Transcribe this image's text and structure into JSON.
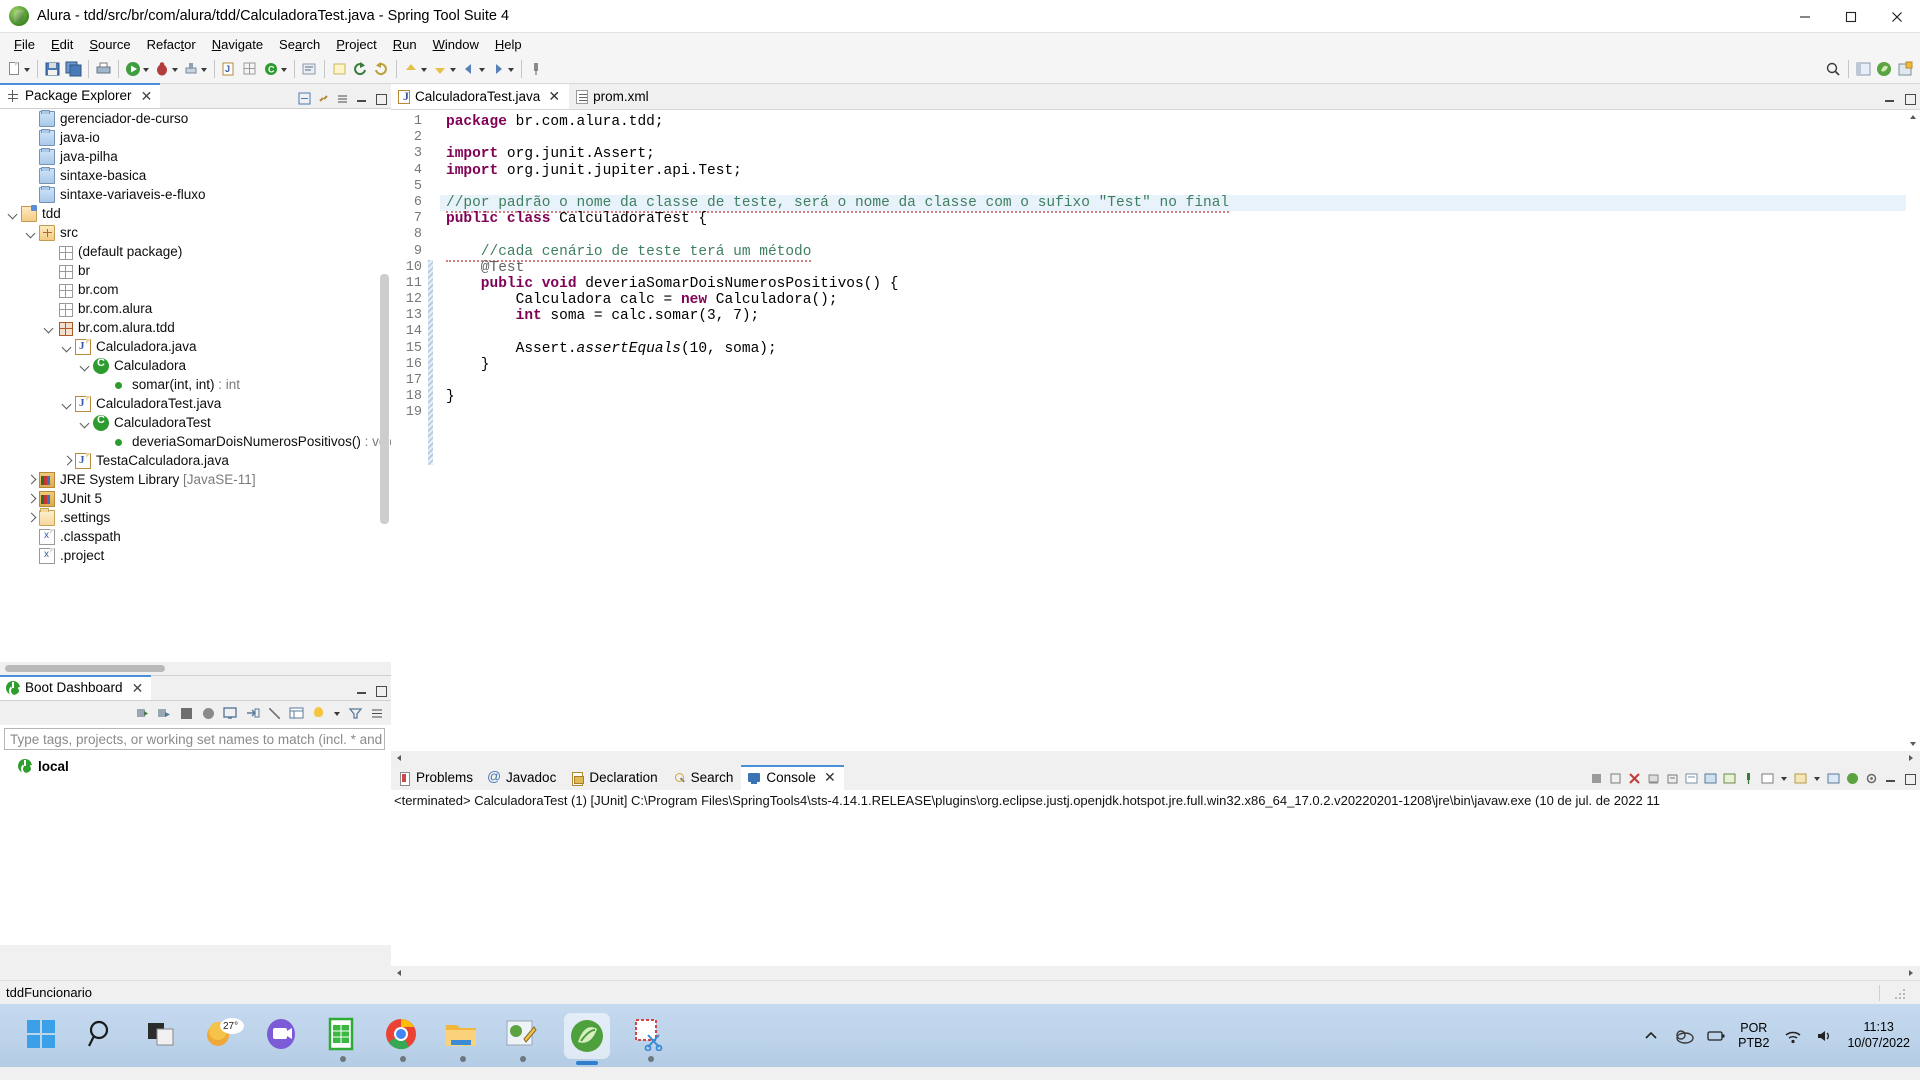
{
  "window": {
    "title": "Alura - tdd/src/br/com/alura/tdd/CalculadoraTest.java - Spring Tool Suite 4",
    "app_icon": "spring-leaf-icon",
    "minimize": "minimize-icon",
    "maximize": "maximize-icon",
    "close": "close-icon"
  },
  "menubar": {
    "items": [
      {
        "label": "File",
        "mnemonic": "F"
      },
      {
        "label": "Edit",
        "mnemonic": "E"
      },
      {
        "label": "Source",
        "mnemonic": "S"
      },
      {
        "label": "Refactor",
        "mnemonic": "t"
      },
      {
        "label": "Navigate",
        "mnemonic": "N"
      },
      {
        "label": "Search",
        "mnemonic": "a"
      },
      {
        "label": "Project",
        "mnemonic": "P"
      },
      {
        "label": "Run",
        "mnemonic": "R"
      },
      {
        "label": "Window",
        "mnemonic": "W"
      },
      {
        "label": "Help",
        "mnemonic": "H"
      }
    ]
  },
  "package_explorer": {
    "tab_label": "Package Explorer",
    "tab_icon": "package-explorer-icon",
    "close_icon": "close-icon",
    "tree": [
      {
        "label": "gerenciador-de-curso",
        "indent": 1,
        "twisty": "none",
        "icon": "project-folder-icon"
      },
      {
        "label": "java-io",
        "indent": 1,
        "twisty": "none",
        "icon": "project-folder-icon"
      },
      {
        "label": "java-pilha",
        "indent": 1,
        "twisty": "none",
        "icon": "project-folder-icon"
      },
      {
        "label": "sintaxe-basica",
        "indent": 1,
        "twisty": "none",
        "icon": "project-folder-icon"
      },
      {
        "label": "sintaxe-variaveis-e-fluxo",
        "indent": 1,
        "twisty": "none",
        "icon": "project-folder-icon"
      },
      {
        "label": "tdd",
        "indent": 0,
        "twisty": "open",
        "icon": "open-project-folder-icon"
      },
      {
        "label": "src",
        "indent": 1,
        "twisty": "open",
        "icon": "source-folder-icon"
      },
      {
        "label": "(default package)",
        "indent": 2,
        "twisty": "none",
        "icon": "package-icon"
      },
      {
        "label": "br",
        "indent": 2,
        "twisty": "none",
        "icon": "package-icon"
      },
      {
        "label": "br.com",
        "indent": 2,
        "twisty": "none",
        "icon": "package-icon"
      },
      {
        "label": "br.com.alura",
        "indent": 2,
        "twisty": "none",
        "icon": "package-icon"
      },
      {
        "label": "br.com.alura.tdd",
        "indent": 2,
        "twisty": "open",
        "icon": "package-selected-icon"
      },
      {
        "label": "Calculadora.java",
        "indent": 3,
        "twisty": "open",
        "icon": "java-file-icon"
      },
      {
        "label": "Calculadora",
        "indent": 4,
        "twisty": "open",
        "icon": "class-icon"
      },
      {
        "label": "somar(int, int)",
        "suffix": " : int",
        "indent": 5,
        "twisty": "none",
        "icon": "method-icon"
      },
      {
        "label": "CalculadoraTest.java",
        "indent": 3,
        "twisty": "open",
        "icon": "java-file-icon"
      },
      {
        "label": "CalculadoraTest",
        "indent": 4,
        "twisty": "open",
        "icon": "class-icon"
      },
      {
        "label": "deveriaSomarDoisNumerosPositivos()",
        "suffix": " : void",
        "indent": 5,
        "twisty": "none",
        "icon": "method-icon"
      },
      {
        "label": "TestaCalculadora.java",
        "indent": 3,
        "twisty": "closed",
        "icon": "java-file-icon"
      },
      {
        "label": "JRE System Library",
        "suffix": " [JavaSE-11]",
        "indent": 1,
        "twisty": "closed",
        "icon": "library-icon"
      },
      {
        "label": "JUnit 5",
        "indent": 1,
        "twisty": "closed",
        "icon": "library-icon"
      },
      {
        "label": ".settings",
        "indent": 1,
        "twisty": "closed",
        "icon": "folder-icon"
      },
      {
        "label": ".classpath",
        "indent": 1,
        "twisty": "none",
        "icon": "xml-file-icon"
      },
      {
        "label": ".project",
        "indent": 1,
        "twisty": "none",
        "icon": "xml-file-icon"
      }
    ]
  },
  "boot_dashboard": {
    "tab_label": "Boot Dashboard",
    "tab_icon": "spring-boot-icon",
    "close_icon": "close-icon",
    "search_placeholder": "Type tags, projects, or working set names to match (incl. * and ? wildc",
    "entries": [
      {
        "label": "local",
        "icon": "spring-boot-icon"
      }
    ]
  },
  "editor": {
    "tabs": [
      {
        "label": "CalculadoraTest.java",
        "icon": "java-file-icon",
        "active": true,
        "closable": true
      },
      {
        "label": "prom.xml",
        "icon": "xml-file-icon",
        "active": false,
        "closable": false
      }
    ],
    "lines": [
      {
        "n": 1,
        "fold": false,
        "highlight": false
      },
      {
        "n": 2,
        "fold": false,
        "highlight": false
      },
      {
        "n": 3,
        "fold": true,
        "highlight": false
      },
      {
        "n": 4,
        "fold": false,
        "highlight": false
      },
      {
        "n": 5,
        "fold": false,
        "highlight": false
      },
      {
        "n": 6,
        "fold": false,
        "highlight": true
      },
      {
        "n": 7,
        "fold": false,
        "highlight": false
      },
      {
        "n": 8,
        "fold": false,
        "highlight": false
      },
      {
        "n": 9,
        "fold": false,
        "highlight": false
      },
      {
        "n": 10,
        "fold": true,
        "highlight": false
      },
      {
        "n": 11,
        "fold": false,
        "highlight": false
      },
      {
        "n": 12,
        "fold": false,
        "highlight": false
      },
      {
        "n": 13,
        "fold": false,
        "highlight": false
      },
      {
        "n": 14,
        "fold": false,
        "highlight": false
      },
      {
        "n": 15,
        "fold": false,
        "highlight": false
      },
      {
        "n": 16,
        "fold": false,
        "highlight": false
      },
      {
        "n": 17,
        "fold": false,
        "highlight": false
      },
      {
        "n": 18,
        "fold": false,
        "highlight": false
      },
      {
        "n": 19,
        "fold": false,
        "highlight": false
      }
    ],
    "code": {
      "l1_kw": "package",
      "l1_rest": " br.com.alura.tdd;",
      "l3_kw": "import",
      "l3_rest": " org.junit.Assert;",
      "l4_kw": "import",
      "l4_rest": " org.junit.jupiter.api.Test;",
      "l6_comment": "//por padrão o nome da classe de teste, será o nome da classe com o sufixo \"Test\" no final",
      "l7_kw": "public class",
      "l7_rest": " CalculadoraTest {",
      "l9_comment": "    //cada cenário de teste terá um método",
      "l10_ann": "    @Test",
      "l11_kw": "    public void",
      "l11_rest": " deveriaSomarDoisNumerosPositivos() {",
      "l12_a": "        Calculadora calc = ",
      "l12_kw": "new",
      "l12_b": " Calculadora();",
      "l13_kw": "        int",
      "l13_a": " soma = calc.somar(3, 7);",
      "l15_a": "        Assert.",
      "l15_m": "assertEquals",
      "l15_b": "(10, soma);",
      "l16": "    }",
      "l18": "}"
    }
  },
  "bottom_panel": {
    "tabs": [
      {
        "label": "Problems",
        "icon": "problems-icon",
        "active": false
      },
      {
        "label": "Javadoc",
        "icon": "javadoc-icon",
        "active": false
      },
      {
        "label": "Declaration",
        "icon": "declaration-icon",
        "active": false
      },
      {
        "label": "Search",
        "icon": "search-icon",
        "active": false
      },
      {
        "label": "Console",
        "icon": "console-icon",
        "active": true
      }
    ],
    "console_output": "<terminated> CalculadoraTest (1) [JUnit] C:\\Program Files\\SpringTools4\\sts-4.14.1.RELEASE\\plugins\\org.eclipse.justj.openjdk.hotspot.jre.full.win32.x86_64_17.0.2.v20220201-1208\\jre\\bin\\javaw.exe  (10 de jul. de 2022 11"
  },
  "statusbar": {
    "text": "tddFuncionario"
  },
  "taskbar": {
    "items": [
      {
        "name": "start-button",
        "icon": "windows-logo-icon"
      },
      {
        "name": "search-taskbar",
        "icon": "magnifier-icon"
      },
      {
        "name": "task-view",
        "icon": "task-view-icon"
      },
      {
        "name": "weather-widget",
        "icon": "weather-icon",
        "label": "27°"
      },
      {
        "name": "microsoft-teams",
        "icon": "teams-icon"
      },
      {
        "name": "libreoffice-calc",
        "icon": "spreadsheet-icon"
      },
      {
        "name": "google-chrome",
        "icon": "chrome-icon"
      },
      {
        "name": "file-explorer",
        "icon": "folder-icon"
      },
      {
        "name": "paint",
        "icon": "paint-icon"
      },
      {
        "name": "spring-tool-suite",
        "icon": "spring-leaf-icon"
      },
      {
        "name": "snipping-tool",
        "icon": "scissors-icon"
      }
    ],
    "tray": {
      "chevron": "show-hidden-icons",
      "cloud": "onedrive-icon",
      "battery": "battery-icon",
      "lang_line1": "POR",
      "lang_line2": "PTB2",
      "wifi": "wifi-icon",
      "volume": "volume-icon",
      "time": "11:13",
      "date": "10/07/2022"
    }
  }
}
